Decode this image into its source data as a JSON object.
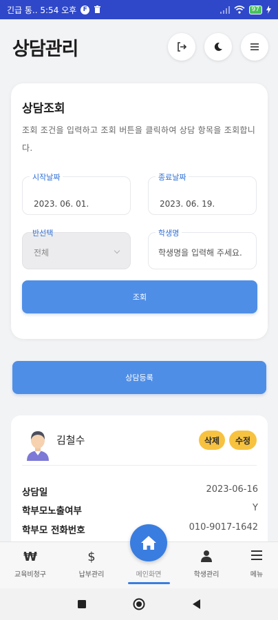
{
  "statusbar": {
    "left_text": "긴급 통.. 5:54 오후",
    "icon_f": "F",
    "battery": "97"
  },
  "header": {
    "title": "상담관리"
  },
  "search_card": {
    "title": "상담조회",
    "description": "조회 조건을 입력하고 조회 버튼을 클릭하여 상담 항목을 조회합니다.",
    "start_date": {
      "label": "시작날짜",
      "value": "2023. 06. 01."
    },
    "end_date": {
      "label": "종료날짜",
      "value": "2023. 06. 19."
    },
    "class_select": {
      "label": "반선택",
      "value": "전체"
    },
    "student_name": {
      "label": "학생명",
      "placeholder": "학생명을 입력해 주세요."
    },
    "search_button": "조회"
  },
  "register_button": "상담등록",
  "record": {
    "name": "김철수",
    "delete_label": "삭제",
    "edit_label": "수정",
    "rows": [
      {
        "key": "상담일",
        "value": "2023-06-16"
      },
      {
        "key": "학부모노출여부",
        "value": "Y"
      },
      {
        "key": "학부모 전화번호",
        "value": "010-9017-1642"
      }
    ]
  },
  "bottom_nav": {
    "items": [
      {
        "label": "교육비청구",
        "icon": "won-icon",
        "glyph": "₩"
      },
      {
        "label": "납부관리",
        "icon": "dollar-icon",
        "glyph": "$"
      },
      {
        "label": "메인화면",
        "icon": "home-icon"
      },
      {
        "label": "학생관리",
        "icon": "person-icon"
      },
      {
        "label": "메뉴",
        "icon": "hamburger-icon"
      }
    ]
  },
  "colors": {
    "status_bar": "#2f48c9",
    "primary_button": "#4f8ee6",
    "tag": "#f7c23f",
    "home_fab": "#3a7de0"
  }
}
